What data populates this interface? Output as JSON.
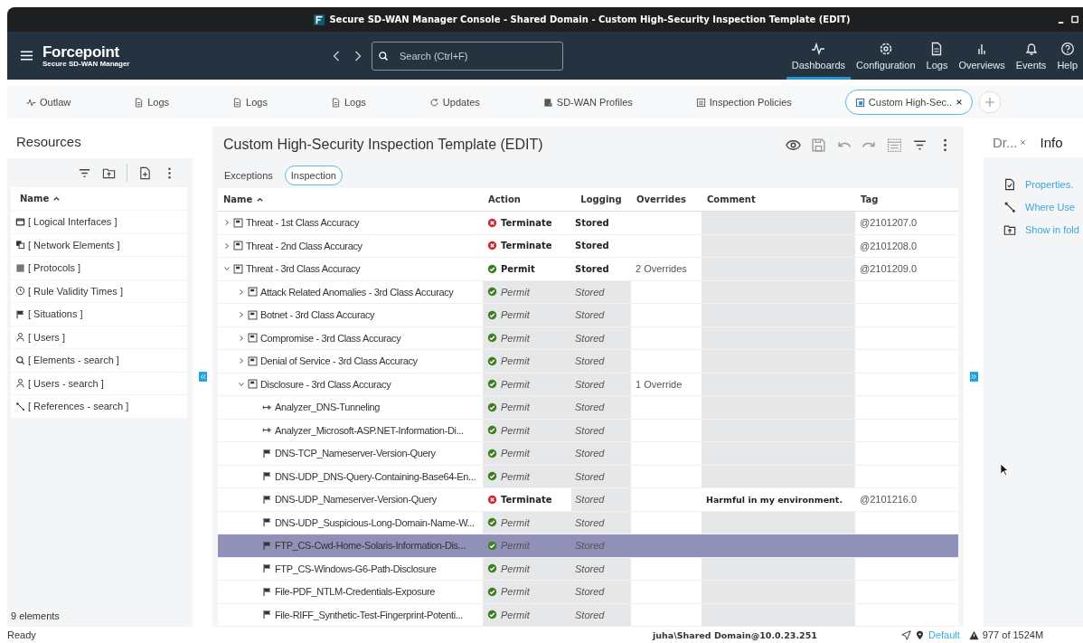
{
  "window": {
    "title": "Secure SD-WAN Manager Console - Shared Domain - Custom High-Security Inspection Template (EDIT)"
  },
  "header": {
    "brand": "Forcepoint",
    "product": "Secure SD-WAN Manager",
    "search": {
      "placeholder": "Search (Ctrl+F)"
    },
    "nav": [
      {
        "label": "Dashboards",
        "kind": "pulse",
        "selected": true
      },
      {
        "label": "Configuration",
        "kind": "gear",
        "selected": false
      },
      {
        "label": "Logs",
        "kind": "doc",
        "selected": false
      },
      {
        "label": "Overviews",
        "kind": "bars",
        "selected": false
      },
      {
        "label": "Events",
        "kind": "bell",
        "selected": false
      },
      {
        "label": "Help",
        "kind": "help",
        "selected": false
      }
    ]
  },
  "tabs": [
    {
      "label": "Outlaw",
      "kind": "pulse",
      "selected": false
    },
    {
      "label": "Logs",
      "kind": "doc",
      "selected": false
    },
    {
      "label": "Logs",
      "kind": "doc",
      "selected": false
    },
    {
      "label": "Logs",
      "kind": "doc",
      "selected": false
    },
    {
      "label": "Updates",
      "kind": "refresh",
      "selected": false
    },
    {
      "label": "SD-WAN Profiles",
      "kind": "profile",
      "selected": false
    },
    {
      "label": "Inspection Policies",
      "kind": "list",
      "selected": false
    },
    {
      "label": "Custom High-Sec..",
      "kind": "template",
      "selected": true,
      "closable": true
    }
  ],
  "resources": {
    "title": "Resources",
    "column": "Name",
    "items": [
      {
        "label": "[ Logical Interfaces ]",
        "kind": "window"
      },
      {
        "label": "[ Network Elements ]",
        "kind": "network"
      },
      {
        "label": "[ Protocols ]",
        "kind": "block"
      },
      {
        "label": "[ Rule Validity Times ]",
        "kind": "clock"
      },
      {
        "label": "[ Situations ]",
        "kind": "flag"
      },
      {
        "label": "[ Users ]",
        "kind": "user"
      },
      {
        "label": "[ Elements - search ]",
        "kind": "search"
      },
      {
        "label": "[ Users - search ]",
        "kind": "user"
      },
      {
        "label": "[ References - search ]",
        "kind": "link"
      }
    ],
    "count": "9 elements"
  },
  "editor": {
    "title": "Custom High-Security Inspection Template (EDIT)",
    "tabs": [
      {
        "label": "Exceptions",
        "selected": false
      },
      {
        "label": "Inspection",
        "selected": true
      }
    ],
    "columns": [
      "Name",
      "Action",
      "Logging",
      "Overrides",
      "Comment",
      "Tag"
    ],
    "rows": [
      {
        "name": "Threat - 1st Class Accuracy",
        "kind": "category",
        "expanded": false,
        "action": {
          "kind": "terminate",
          "text": "Terminate",
          "inherited": false
        },
        "logging": {
          "text": "Stored",
          "inherited": false
        },
        "tag": "@2101207.0",
        "selected": false
      },
      {
        "name": "Threat - 2nd Class Accuracy",
        "kind": "category",
        "expanded": false,
        "action": {
          "kind": "terminate",
          "text": "Terminate",
          "inherited": false
        },
        "logging": {
          "text": "Stored",
          "inherited": false
        },
        "tag": "@2101208.0",
        "selected": false
      },
      {
        "name": "Threat - 3rd Class Accuracy",
        "kind": "category",
        "expanded": true,
        "action": {
          "kind": "permit",
          "text": "Permit",
          "inherited": false
        },
        "logging": {
          "text": "Stored",
          "inherited": false
        },
        "overrides": "2 Overrides",
        "tag": "@2101209.0",
        "selected": false,
        "children": [
          {
            "name": "Attack Related Anomalies - 3rd Class Accuracy",
            "kind": "category",
            "expanded": false,
            "action": {
              "kind": "permit",
              "text": "Permit",
              "inherited": true
            },
            "logging": {
              "text": "Stored",
              "inherited": true
            },
            "selected": false
          },
          {
            "name": "Botnet - 3rd Class Accuracy",
            "kind": "category",
            "expanded": false,
            "action": {
              "kind": "permit",
              "text": "Permit",
              "inherited": true
            },
            "logging": {
              "text": "Stored",
              "inherited": true
            },
            "selected": false
          },
          {
            "name": "Compromise - 3rd Class Accuracy",
            "kind": "category",
            "expanded": false,
            "action": {
              "kind": "permit",
              "text": "Permit",
              "inherited": true
            },
            "logging": {
              "text": "Stored",
              "inherited": true
            },
            "selected": false
          },
          {
            "name": "Denial of Service - 3rd Class Accuracy",
            "kind": "category",
            "expanded": false,
            "action": {
              "kind": "permit",
              "text": "Permit",
              "inherited": true
            },
            "logging": {
              "text": "Stored",
              "inherited": true
            },
            "selected": false
          },
          {
            "name": "Disclosure - 3rd Class Accuracy",
            "kind": "category",
            "expanded": true,
            "action": {
              "kind": "permit",
              "text": "Permit",
              "inherited": true
            },
            "logging": {
              "text": "Stored",
              "inherited": true
            },
            "overrides": "1 Override",
            "selected": false,
            "children": [
              {
                "name": "Analyzer_DNS-Tunneling",
                "kind": "analyzer",
                "action": {
                  "kind": "permit",
                  "text": "Permit",
                  "inherited": true
                },
                "logging": {
                  "text": "Stored",
                  "inherited": true
                },
                "selected": false
              },
              {
                "name": "Analyzer_Microsoft-ASP.NET-Information-Di...",
                "kind": "analyzer",
                "action": {
                  "kind": "permit",
                  "text": "Permit",
                  "inherited": true
                },
                "logging": {
                  "text": "Stored",
                  "inherited": true
                },
                "selected": false
              },
              {
                "name": "DNS-TCP_Nameserver-Version-Query",
                "kind": "situation",
                "action": {
                  "kind": "permit",
                  "text": "Permit",
                  "inherited": true
                },
                "logging": {
                  "text": "Stored",
                  "inherited": true
                },
                "selected": false
              },
              {
                "name": "DNS-UDP_DNS-Query-Containing-Base64-En...",
                "kind": "situation",
                "action": {
                  "kind": "permit",
                  "text": "Permit",
                  "inherited": true
                },
                "logging": {
                  "text": "Stored",
                  "inherited": true
                },
                "selected": false
              },
              {
                "name": "DNS-UDP_Nameserver-Version-Query",
                "kind": "situation",
                "action": {
                  "kind": "terminate",
                  "text": "Terminate",
                  "inherited": false
                },
                "logging": {
                  "text": "Stored",
                  "inherited": true
                },
                "comment": "Harmful in my environment.",
                "tag": "@2101216.0",
                "selected": false
              },
              {
                "name": "DNS-UDP_Suspicious-Long-Domain-Name-W...",
                "kind": "situation",
                "action": {
                  "kind": "permit",
                  "text": "Permit",
                  "inherited": true
                },
                "logging": {
                  "text": "Stored",
                  "inherited": true
                },
                "selected": false
              },
              {
                "name": "FTP_CS-Cwd-Home-Solaris-Information-Dis...",
                "kind": "situation",
                "action": {
                  "kind": "permit",
                  "text": "Permit",
                  "inherited": true
                },
                "logging": {
                  "text": "Stored",
                  "inherited": true
                },
                "selected": true
              },
              {
                "name": "FTP_CS-Windows-G6-Path-Disclosure",
                "kind": "situation",
                "action": {
                  "kind": "permit",
                  "text": "Permit",
                  "inherited": true
                },
                "logging": {
                  "text": "Stored",
                  "inherited": true
                },
                "selected": false
              },
              {
                "name": "File-PDF_NTLM-Credentials-Exposure",
                "kind": "situation",
                "action": {
                  "kind": "permit",
                  "text": "Permit",
                  "inherited": true
                },
                "logging": {
                  "text": "Stored",
                  "inherited": true
                },
                "selected": false
              },
              {
                "name": "File-RIFF_Synthetic-Test-Fingerprint-Potenti...",
                "kind": "situation",
                "action": {
                  "kind": "permit",
                  "text": "Permit",
                  "inherited": true
                },
                "logging": {
                  "text": "Stored",
                  "inherited": true
                },
                "selected": false
              }
            ]
          }
        ]
      }
    ]
  },
  "side_panel": {
    "tabs": [
      {
        "label": "Dr...",
        "selected": false,
        "closable": true
      },
      {
        "label": "Info",
        "selected": true
      }
    ],
    "links": [
      {
        "label": "Properties.",
        "kind": "doc-check"
      },
      {
        "label": "Where Use",
        "kind": "link"
      },
      {
        "label": "Show in fold",
        "kind": "folder"
      }
    ]
  },
  "status_bar": {
    "text": "Ready",
    "user": "juha\\Shared Domain@10.0.23.251",
    "location": "Default",
    "memory": "977 of 1524M"
  }
}
